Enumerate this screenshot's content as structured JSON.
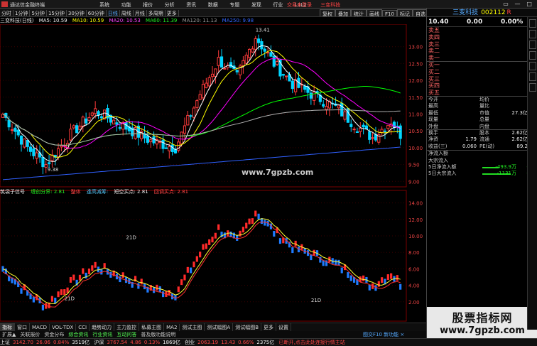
{
  "titlebar": {
    "app_name": "通达信金融终端",
    "menus": [
      "系统",
      "功能",
      "报价",
      "分析",
      "资讯",
      "数据",
      "专题",
      "发现",
      "行业",
      "L1L2"
    ],
    "center_items": [
      "交易未登录",
      "三变科技"
    ],
    "win_buttons": [
      "▭",
      "—",
      "□",
      "✕"
    ]
  },
  "toolbar": {
    "periods": [
      "分时",
      "1分钟",
      "5分钟",
      "15分钟",
      "30分钟",
      "60分钟",
      "日线",
      "周线",
      "月线",
      "多周期",
      "更多"
    ],
    "selected": "日线",
    "right_buttons": [
      "复权",
      "叠加",
      "统计",
      "画线",
      "F10",
      "标记",
      "自选",
      "返回"
    ]
  },
  "legend1": {
    "stock": "三变科技(日线)",
    "ma5": "MA5: 10.59",
    "ma10": "MA10: 10.59",
    "ma20": "MA20: 10.53",
    "ma60": "MA60: 11.39",
    "ma120": "MA120: 11.13",
    "ma250": "MA250: 9.98"
  },
  "price_axis": [
    "13.00",
    "12.50",
    "12.00",
    "11.50",
    "11.00",
    "10.50",
    "10.00",
    "9.50",
    "9.00"
  ],
  "annotations": {
    "high_label": "13.41",
    "low_label": "9.38"
  },
  "indicator": {
    "name": "筑袋子信号",
    "cut": "缠创分界: 2.81",
    "p1": "整体",
    "p2": "逢高减筹:",
    "p3": "短空买点: 2.81",
    "p4": "回调买点: 2.81",
    "axis": [
      "14.00",
      "12.00",
      "10.00",
      "8.00",
      "6.00",
      "4.00",
      "2.00"
    ],
    "tag": "21D"
  },
  "watermark": "www.7gpzb.com",
  "date_axis": {
    "year": "2023年",
    "months": [
      "4",
      "5",
      "6",
      "7",
      "8",
      "9"
    ],
    "right_label": "日线"
  },
  "panel_tabs": [
    "指标",
    "窗口",
    "MACD",
    "VOL-TDX",
    "CCI",
    "趋势动力",
    "主力监控",
    "私募主图",
    "MA2",
    "测试主图",
    "测试幅图A",
    "测试幅图B",
    "更多",
    "设置"
  ],
  "panel_tab_selected": "指标",
  "func_tabs": [
    "扩展▲",
    "关联报价",
    "资金分布",
    "综合资讯",
    "行业资讯",
    "互动问答",
    "普及版功能说明"
  ],
  "func_tabs_right": "图交F10 新功能 ×",
  "statusbar": {
    "sh_label": "上证",
    "sh_val": "3142.70",
    "sh_chg": "26.06",
    "sh_pct": "0.84%",
    "sh_amt": "3519亿",
    "hs_label": "沪深",
    "hs_val": "3767.54",
    "hs_chg": "4.86",
    "hs_pct": "0.13%",
    "hs_amt": "1869亿",
    "cy_label": "创业",
    "cy_val": "2063.19",
    "cy_chg": "13.43",
    "cy_pct": "0.66%",
    "cy_amt": "2375亿",
    "right": "已断开,点击此处连接行情主站"
  },
  "side": {
    "name": "三变科技",
    "code": "002112",
    "flag": "R",
    "price": "10.40",
    "change": "0.00",
    "change_pct": "0.00%",
    "sells": [
      "卖五",
      "卖四",
      "卖三",
      "卖二",
      "卖一"
    ],
    "buys": [
      "买一",
      "买二",
      "买三",
      "买四",
      "买五"
    ],
    "quote": [
      {
        "l1": "今开",
        "v1": "",
        "l2": "均价",
        "v2": ""
      },
      {
        "l1": "最高",
        "v1": "",
        "l2": "量比",
        "v2": ""
      },
      {
        "l1": "最低",
        "v1": "",
        "l2": "市值",
        "v2": "27.3亿"
      },
      {
        "l1": "现量",
        "v1": "",
        "l2": "总量",
        "v2": ""
      },
      {
        "l1": "外盘",
        "v1": "",
        "l2": "内盘",
        "v2": ""
      },
      {
        "l1": "换手",
        "v1": "",
        "l2": "股本",
        "v2": "2.62亿"
      },
      {
        "l1": "净资",
        "v1": "1.79",
        "l2": "流通",
        "v2": "2.62亿"
      },
      {
        "l1": "收益(三)",
        "v1": "0.060",
        "l2": "PE(动)",
        "v2": "89.2"
      }
    ],
    "flow": [
      {
        "label": "净流入额",
        "value": "",
        "pct": "",
        "bar": 0
      },
      {
        "label": "大宗流入",
        "value": "",
        "pct": "",
        "bar": 0
      },
      {
        "label": "5日净流入额",
        "value": "-493.9万",
        "pct": "-1%",
        "bar": 0.45
      },
      {
        "label": "5日大宗流入",
        "value": "-1131万",
        "pct": "-3%",
        "bar": 0.8
      }
    ]
  },
  "watermark_box": {
    "line1": "股票指标网",
    "line2": "www.7gpzb.com"
  },
  "colors": {
    "up": "#ff3b3b",
    "down": "#00d4ff",
    "ma5": "#ffffff",
    "ma10": "#ffff00",
    "ma20": "#ff00ff",
    "ma60": "#00ff00",
    "ma120": "#b0b0b0",
    "ma250": "#3060ff"
  }
}
